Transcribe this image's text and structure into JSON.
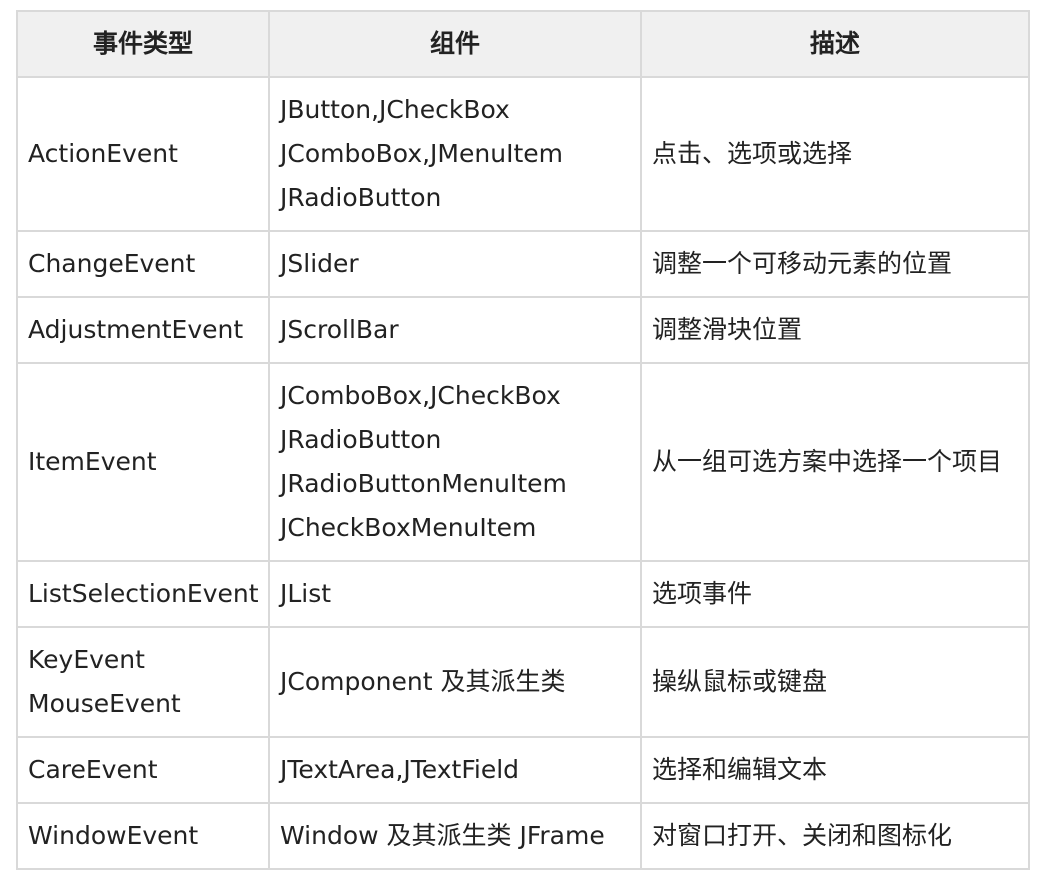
{
  "table": {
    "headers": [
      "事件类型",
      "组件",
      "描述"
    ],
    "rows": [
      {
        "event": [
          "ActionEvent"
        ],
        "components": [
          "JButton,JCheckBox",
          "JComboBox,JMenuItem",
          "JRadioButton"
        ],
        "description": "点击、选项或选择"
      },
      {
        "event": [
          "ChangeEvent"
        ],
        "components": [
          "JSlider"
        ],
        "description": "调整一个可移动元素的位置"
      },
      {
        "event": [
          "AdjustmentEvent"
        ],
        "components": [
          "JScrollBar"
        ],
        "description": "调整滑块位置"
      },
      {
        "event": [
          "ItemEvent"
        ],
        "components": [
          "JComboBox,JCheckBox",
          "JRadioButton",
          "JRadioButtonMenuItem",
          "JCheckBoxMenuItem"
        ],
        "description": "从一组可选方案中选择一个项目"
      },
      {
        "event": [
          "ListSelectionEvent"
        ],
        "components": [
          "JList"
        ],
        "description": "选项事件"
      },
      {
        "event": [
          "KeyEvent",
          "MouseEvent"
        ],
        "components": [
          "JComponent 及其派生类"
        ],
        "description": "操纵鼠标或键盘"
      },
      {
        "event": [
          "CareEvent"
        ],
        "components": [
          "JTextArea,JTextField"
        ],
        "description": "选择和编辑文本"
      },
      {
        "event": [
          "WindowEvent"
        ],
        "components": [
          "Window 及其派生类 JFrame"
        ],
        "description": "对窗口打开、关闭和图标化"
      }
    ]
  }
}
